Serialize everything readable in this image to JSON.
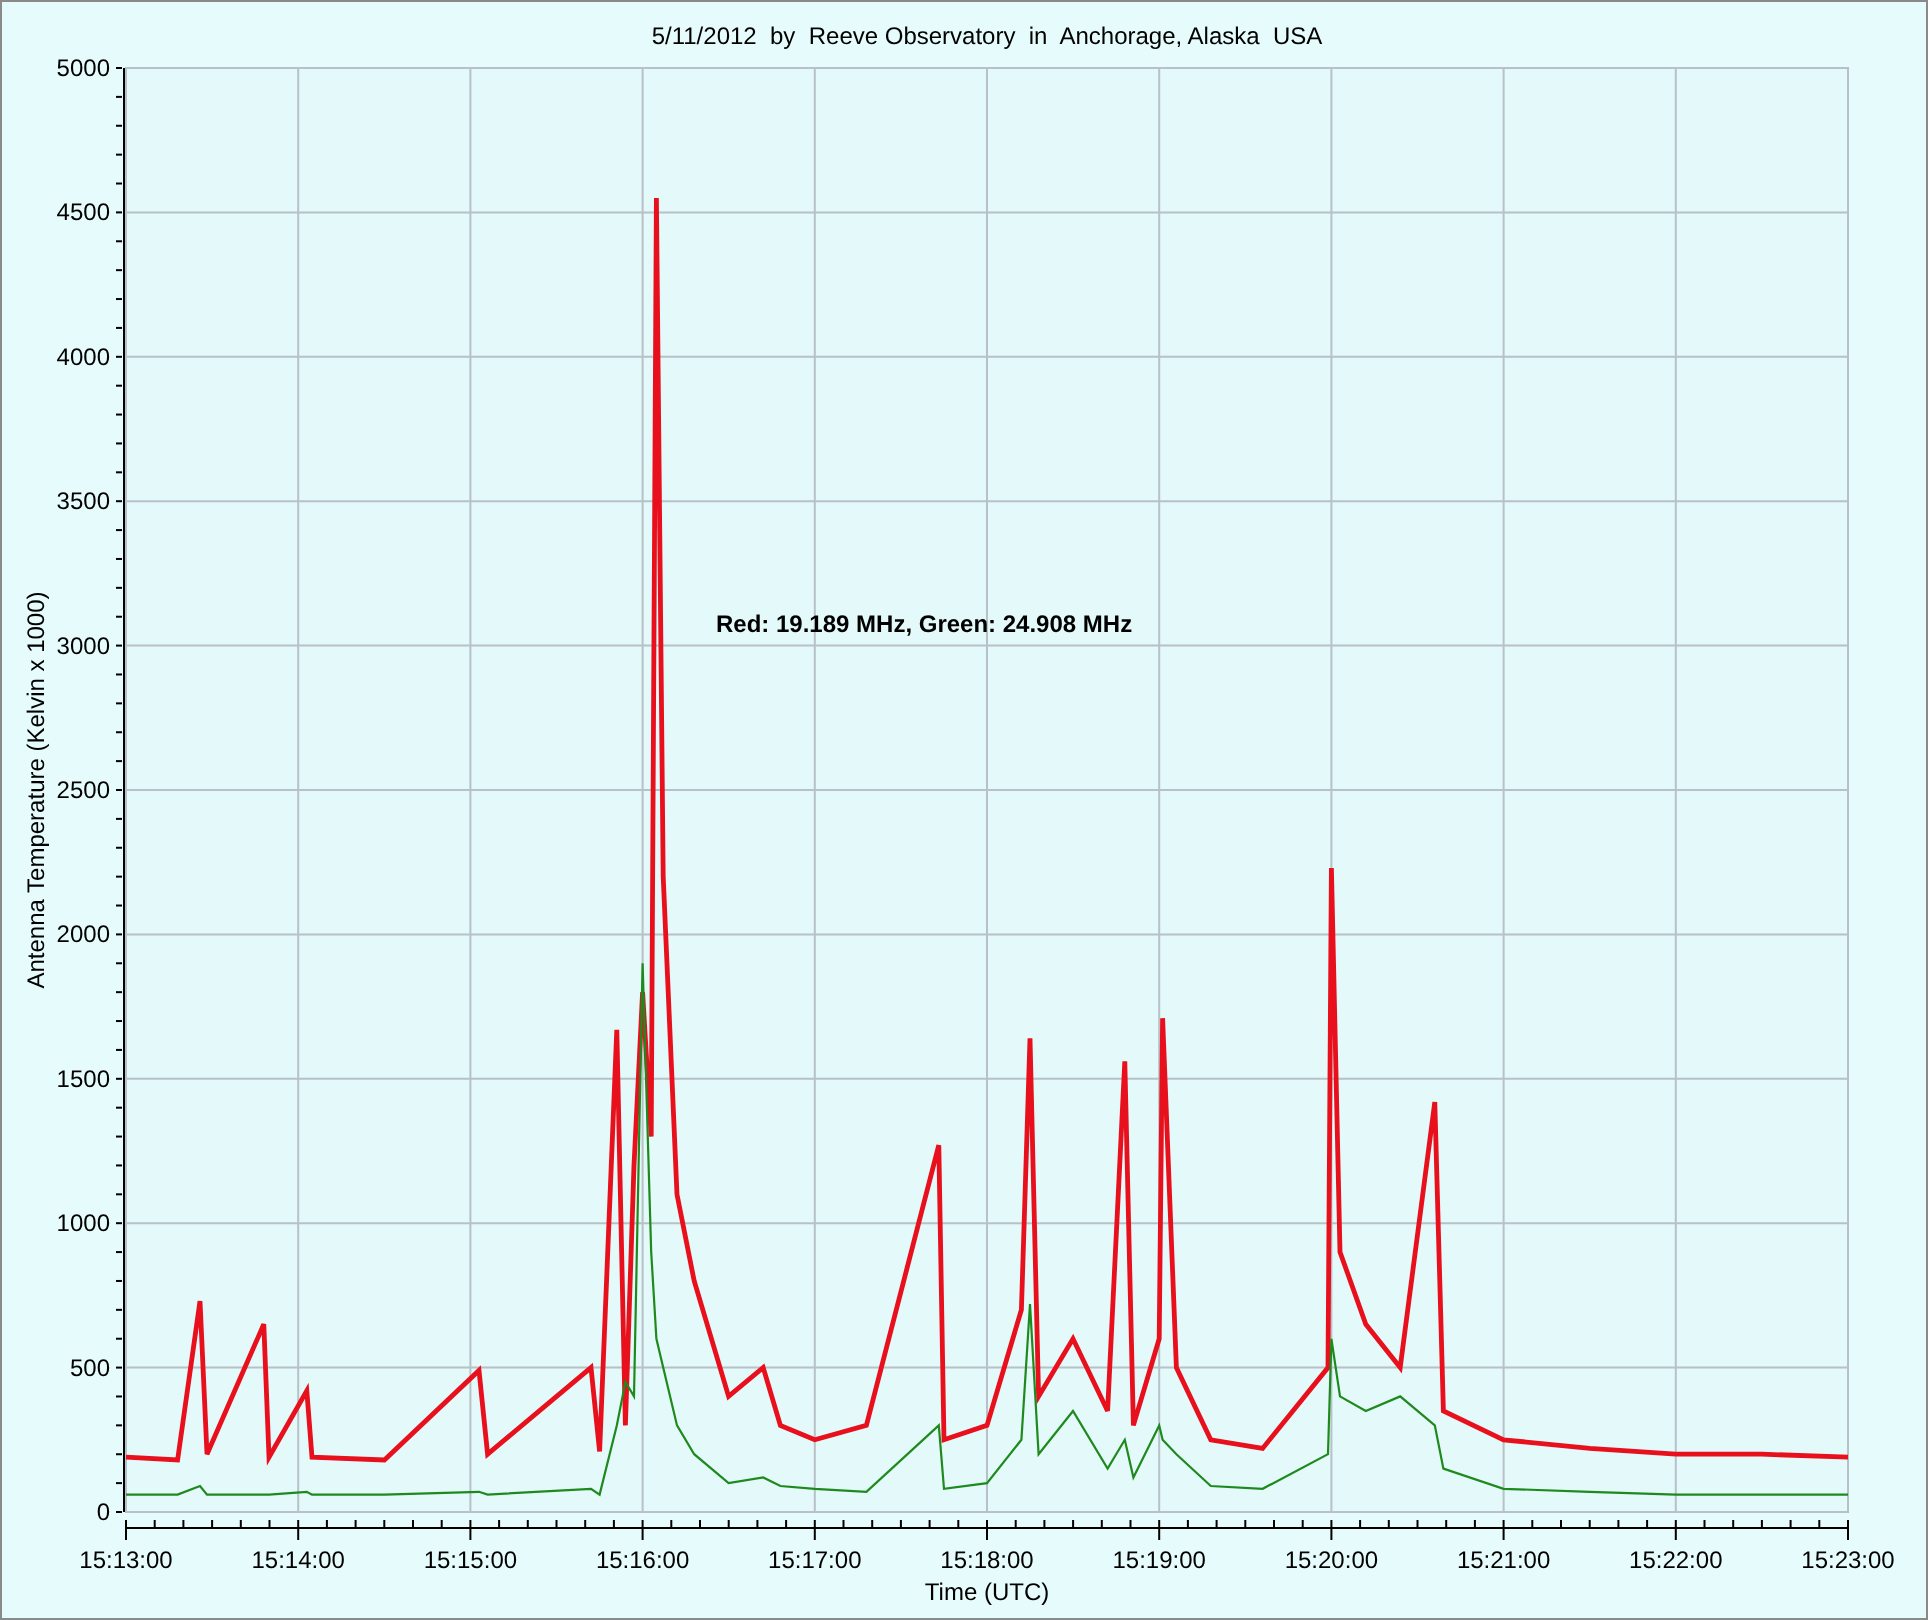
{
  "chart": {
    "chart_data": {
      "type": "line",
      "title": "5/11/2012  by  Reeve Observatory  in  Anchorage, Alaska  USA",
      "xlabel": "Time (UTC)",
      "ylabel": "Antenna Temperature (Kelvin x 1000)",
      "x": [
        54780,
        54798,
        54805.8,
        54808.2,
        54828,
        54829.8,
        54843,
        54844.8,
        54870,
        54903,
        54906,
        54942,
        54945,
        54951,
        54954,
        54957,
        54960,
        54963,
        54964.8,
        54967.2,
        54972,
        54978,
        54990,
        55002,
        55008,
        55020,
        55038,
        55063.2,
        55065,
        55080,
        55092,
        55095,
        55098,
        55110,
        55122,
        55128,
        55131,
        55140,
        55141.2,
        55146,
        55158,
        55176,
        55198.8,
        55200,
        55203,
        55212,
        55224,
        55236,
        55239,
        55260,
        55290,
        55320,
        55350,
        55380
      ],
      "series": [
        {
          "color": "#e8101c",
          "values": [
            190,
            180,
            730,
            200,
            650,
            190,
            420,
            190,
            180,
            490,
            200,
            500,
            210,
            1670,
            300,
            1200,
            1800,
            1300,
            4550,
            2200,
            1100,
            800,
            400,
            500,
            300,
            250,
            300,
            1270,
            250,
            300,
            700,
            1640,
            400,
            600,
            350,
            1560,
            300,
            600,
            1710,
            500,
            250,
            220,
            500,
            2230,
            900,
            650,
            500,
            1420,
            350,
            250,
            220,
            200,
            200,
            190
          ]
        },
        {
          "color": "#1e8a1e",
          "values": [
            60,
            60,
            90,
            60,
            60,
            60,
            70,
            60,
            60,
            70,
            60,
            80,
            60,
            300,
            450,
            400,
            1900,
            900,
            600,
            500,
            300,
            200,
            100,
            120,
            90,
            80,
            70,
            300,
            80,
            100,
            250,
            720,
            200,
            350,
            150,
            250,
            120,
            300,
            250,
            200,
            90,
            80,
            200,
            600,
            400,
            350,
            400,
            300,
            150,
            80,
            70,
            60,
            60,
            60
          ]
        }
      ],
      "grid": true,
      "xlim": [
        54780,
        55380
      ],
      "ylim": [
        0,
        5000
      ],
      "xticks": [
        {
          "value": 54780,
          "label": "15:13:00"
        },
        {
          "value": 54840,
          "label": "15:14:00"
        },
        {
          "value": 54900,
          "label": "15:15:00"
        },
        {
          "value": 54960,
          "label": "15:16:00"
        },
        {
          "value": 55020,
          "label": "15:17:00"
        },
        {
          "value": 55080,
          "label": "15:18:00"
        },
        {
          "value": 55140,
          "label": "15:19:00"
        },
        {
          "value": 55200,
          "label": "15:20:00"
        },
        {
          "value": 55260,
          "label": "15:21:00"
        },
        {
          "value": 55320,
          "label": "15:22:00"
        },
        {
          "value": 55380,
          "label": "15:23:00"
        }
      ],
      "yticks": [
        0,
        500,
        1000,
        1500,
        2000,
        2500,
        3000,
        3500,
        4000,
        4500,
        5000
      ],
      "annotations": [
        "Red: 19.189 MHz, Green: 24.908 MHz"
      ]
    }
  }
}
